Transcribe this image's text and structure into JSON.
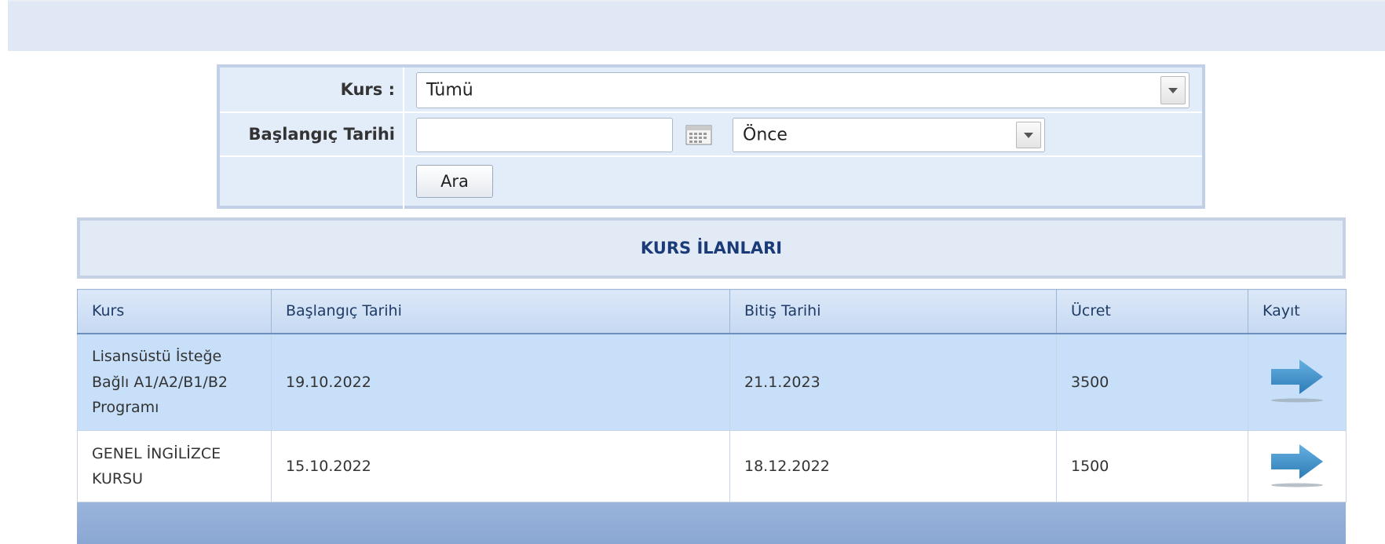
{
  "search": {
    "kurs_label": "Kurs :",
    "kurs_selected": "Tümü",
    "start_date_label": "Başlangıç Tarihi",
    "start_date_value": "",
    "date_filter_selected": "Önce",
    "search_button": "Ara"
  },
  "listing": {
    "title": "KURS İLANLARI",
    "columns": [
      "Kurs",
      "Başlangıç Tarihi",
      "Bitiş Tarihi",
      "Ücret",
      "Kayıt"
    ],
    "rows": [
      {
        "kurs_lines": [
          "Lisansüstü İsteğe",
          "Bağlı A1/A2/B1/B2",
          "Programı"
        ],
        "start": "19.10.2022",
        "end": "21.1.2023",
        "fee": "3500"
      },
      {
        "kurs_lines": [
          "GENEL İNGİLİZCE",
          "KURSU"
        ],
        "start": "15.10.2022",
        "end": "18.12.2022",
        "fee": "1500"
      }
    ]
  },
  "icons": {
    "calendar": "calendar-icon",
    "dropdown": "chevron-down-icon",
    "register": "arrow-right-icon"
  },
  "colors": {
    "header_text": "#1a3b78",
    "selected_row": "#c7dff8",
    "arrow": "#3d8ec9"
  }
}
